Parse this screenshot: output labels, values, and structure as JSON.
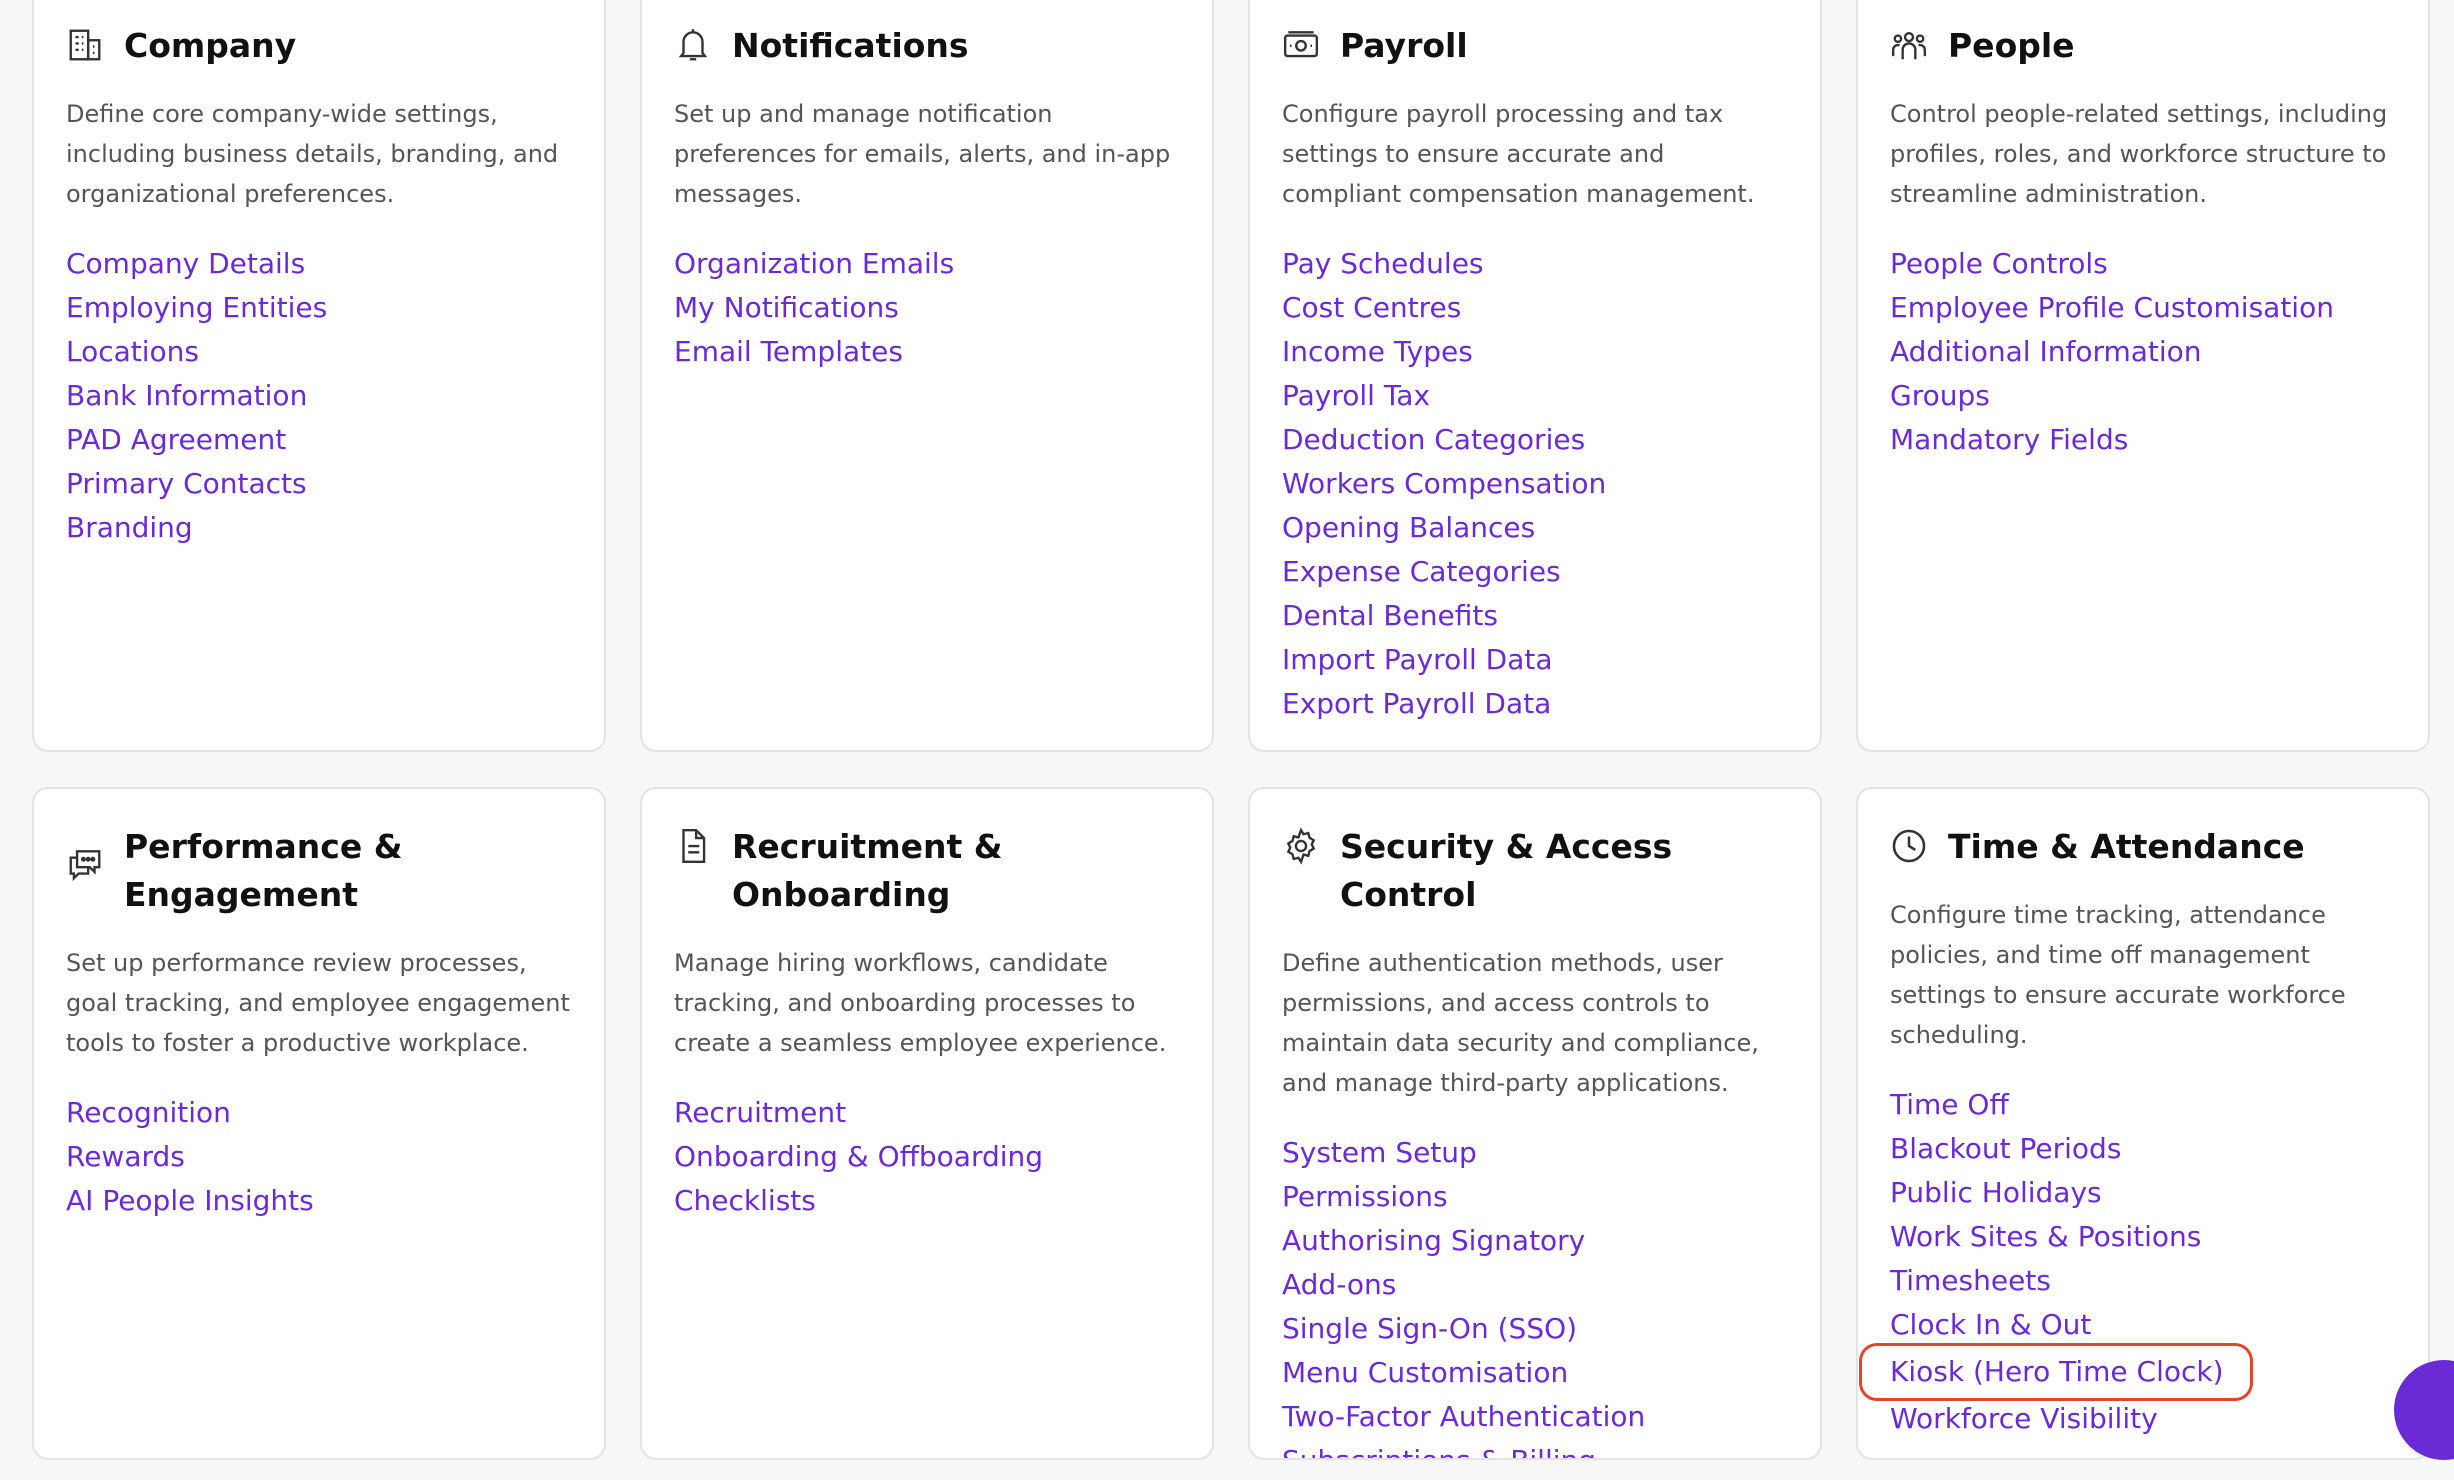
{
  "cards": [
    {
      "title": "Company",
      "description": "Define core company-wide settings, including business details, branding, and organizational preferences.",
      "links": [
        "Company Details",
        "Employing Entities",
        "Locations",
        "Bank Information",
        "PAD Agreement",
        "Primary Contacts",
        "Branding"
      ]
    },
    {
      "title": "Notifications",
      "description": "Set up and manage notification preferences for emails, alerts, and in-app messages.",
      "links": [
        "Organization Emails",
        "My Notifications",
        "Email Templates"
      ]
    },
    {
      "title": "Payroll",
      "description": "Configure payroll processing and tax settings to ensure accurate and compliant compensation management.",
      "links": [
        "Pay Schedules",
        "Cost Centres",
        "Income Types",
        "Payroll Tax",
        "Deduction Categories",
        "Workers Compensation",
        "Opening Balances",
        "Expense Categories",
        "Dental Benefits",
        "Import Payroll Data",
        "Export Payroll Data"
      ]
    },
    {
      "title": "People",
      "description": "Control people-related settings, including profiles, roles, and workforce structure to streamline administration.",
      "links": [
        "People Controls",
        "Employee Profile Customisation",
        "Additional Information",
        "Groups",
        "Mandatory Fields"
      ]
    },
    {
      "title": "Performance & Engagement",
      "description": "Set up performance review processes, goal tracking, and employee engagement tools to foster a productive workplace.",
      "links": [
        "Recognition",
        "Rewards",
        "AI People Insights"
      ]
    },
    {
      "title": "Recruitment & Onboarding",
      "description": "Manage hiring workflows, candidate tracking, and onboarding processes to create a seamless employee experience.",
      "links": [
        "Recruitment",
        "Onboarding & Offboarding",
        "Checklists"
      ]
    },
    {
      "title": "Security & Access Control",
      "description": "Define authentication methods, user permissions, and access controls to maintain data security and compliance, and manage third-party applications.",
      "links": [
        "System Setup",
        "Permissions",
        "Authorising Signatory",
        "Add-ons",
        "Single Sign-On (SSO)",
        "Menu Customisation",
        "Two-Factor Authentication",
        "Subscriptions & Billing"
      ]
    },
    {
      "title": "Time & Attendance",
      "description": "Configure time tracking, attendance policies, and time off management settings to ensure accurate workforce scheduling.",
      "links": [
        "Time Off",
        "Blackout Periods",
        "Public Holidays",
        "Work Sites & Positions",
        "Timesheets",
        "Clock In & Out",
        "Kiosk (Hero Time Clock)",
        "Workforce Visibility"
      ]
    }
  ],
  "icons": [
    "building-icon",
    "bell-icon",
    "money-icon",
    "people-icon",
    "chat-icon",
    "document-icon",
    "gear-icon",
    "clock-icon"
  ],
  "colors": {
    "link": "#6a2bd6",
    "highlight": "#e0462c"
  }
}
